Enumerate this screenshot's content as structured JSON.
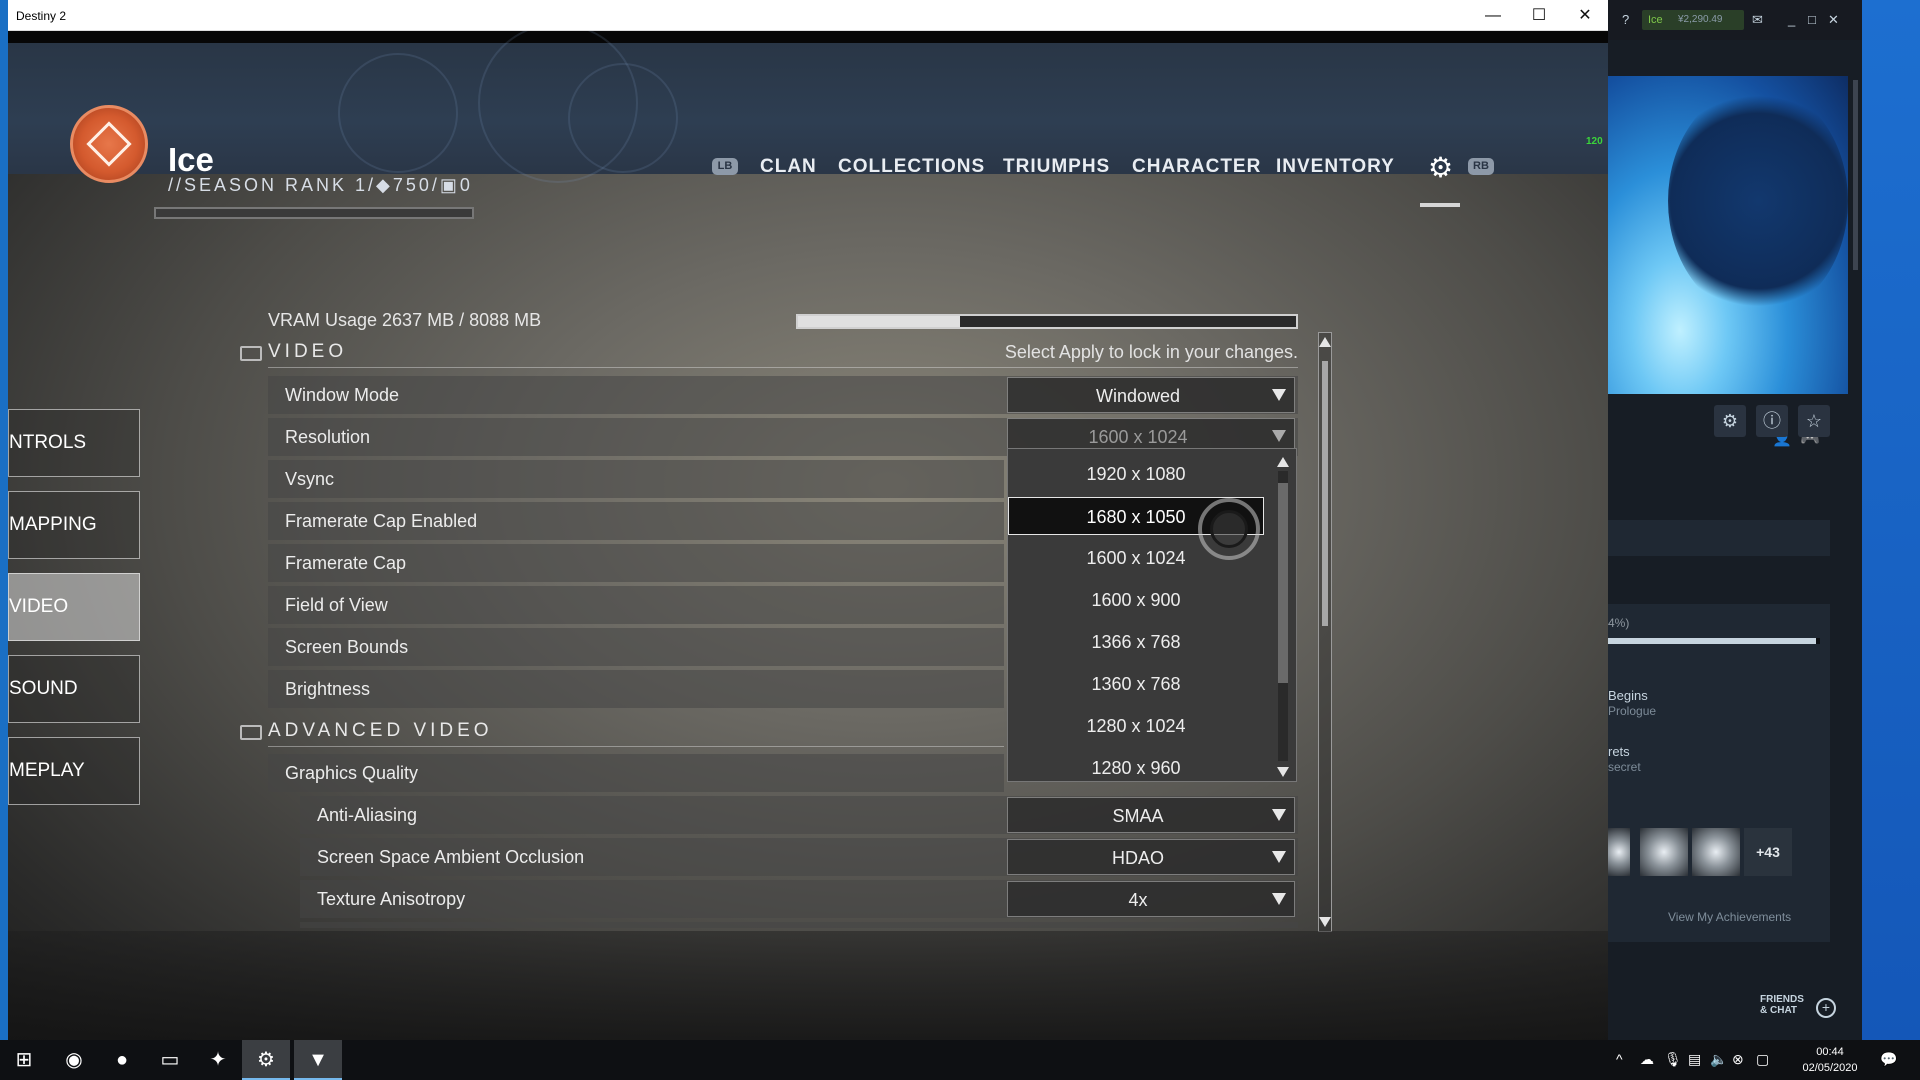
{
  "colors": {
    "accent_green": "#3bd43b",
    "header_bg": "#2e3e52",
    "steam_bg": "#171d25"
  },
  "d2_window": {
    "title": "Destiny 2",
    "controls": {
      "minimize": "—",
      "maximize": "☐",
      "close": "✕"
    }
  },
  "header": {
    "player_name": "Ice",
    "season_rank": "//SEASON RANK 1/◆750/▣0",
    "fps": "120",
    "lb_hint": "LB",
    "rb_hint": "RB",
    "nav": [
      "CLAN",
      "COLLECTIONS",
      "TRIUMPHS",
      "CHARACTER",
      "INVENTORY"
    ],
    "settings_icon": "gear-icon"
  },
  "side_tabs": [
    {
      "label": "NTROLS"
    },
    {
      "label": " MAPPING"
    },
    {
      "label": "VIDEO"
    },
    {
      "label": "SOUND"
    },
    {
      "label": "MEPLAY"
    }
  ],
  "vram": {
    "label": "VRAM Usage 2637 MB / 8088 MB",
    "used_fraction": 0.326
  },
  "video_section": {
    "title": "VIDEO",
    "apply_hint": "Select Apply to lock in your changes."
  },
  "video_rows": [
    {
      "label": "Window Mode",
      "value": "Windowed"
    },
    {
      "label": "Resolution",
      "value": "1600 x 1024"
    },
    {
      "label": "Vsync"
    },
    {
      "label": "Framerate Cap Enabled"
    },
    {
      "label": "Framerate Cap"
    },
    {
      "label": "Field of View"
    },
    {
      "label": "Screen Bounds"
    },
    {
      "label": "Brightness"
    }
  ],
  "advanced_section": {
    "title": "ADVANCED VIDEO"
  },
  "advanced_rows": [
    {
      "label": "Graphics Quality"
    },
    {
      "label": "Anti-Aliasing",
      "value": "SMAA"
    },
    {
      "label": "Screen Space Ambient Occlusion",
      "value": "HDAO"
    },
    {
      "label": "Texture Anisotropy",
      "value": "4x"
    }
  ],
  "resolution_options": [
    "1920 x 1080",
    "1680 x 1050",
    "1600 x 1024",
    "1600 x 900",
    "1366 x 768",
    "1360 x 768",
    "1280 x 1024",
    "1280 x 960"
  ],
  "resolution_highlighted": "1680 x 1050",
  "steam": {
    "help": "?",
    "username": "Ice",
    "balance": "¥2,290.49",
    "progress_text": "4%)",
    "progress_fraction": 0.98,
    "achievements": [
      {
        "title": "Begins",
        "sub": "Prologue"
      },
      {
        "title": "rets",
        "sub": "secret"
      }
    ],
    "more_count": "+43",
    "view_link": "View My Achievements",
    "friends_chat_line1": "FRIENDS",
    "friends_chat_line2": "& CHAT"
  },
  "taskbar": {
    "time": "00:44",
    "date": "02/05/2020",
    "apps": [
      "windows-start-icon",
      "chrome-icon",
      "app-icon",
      "file-explorer-icon",
      "figma-icon",
      "steam-icon",
      "destiny-icon"
    ]
  }
}
